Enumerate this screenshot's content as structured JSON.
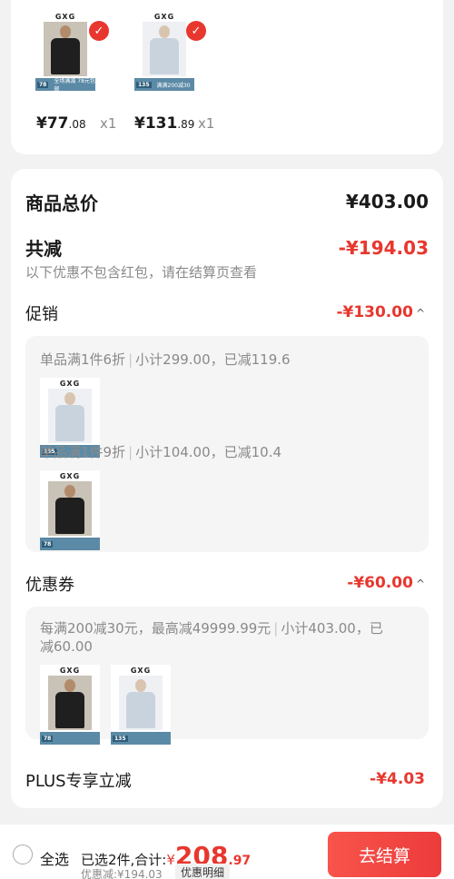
{
  "products": [
    {
      "brand": "GXG",
      "band_price": "78",
      "band_text": "全场满减 78元包邮",
      "price_int": "¥77",
      "price_dec": ".08",
      "qty": "x1",
      "variant": "dark"
    },
    {
      "brand": "GXG",
      "band_price": "135",
      "band_text": "满满200减30",
      "price_int": "¥131",
      "price_dec": ".89",
      "qty": "x1",
      "variant": "light"
    }
  ],
  "summary": {
    "total_label": "商品总价",
    "total_value": "¥403.00",
    "reduce_label": "共减",
    "reduce_value": "-¥194.03",
    "note": "以下优惠不包含红包，请在结算页查看"
  },
  "promo": {
    "label": "促销",
    "value": "-¥130.00",
    "caret": "^",
    "rules": [
      {
        "rule": "单品满1件6折",
        "detail": "小计299.00，已减119.6"
      },
      {
        "rule": "单品满1件9折",
        "detail": "小计104.00，已减10.4"
      }
    ]
  },
  "coupon": {
    "label": "优惠券",
    "value": "-¥60.00",
    "caret": "^",
    "rule_line1": "每满200减30元，最高减49999.99元",
    "rule_line1b": "小计403.00，已",
    "rule_line2": "减60.00"
  },
  "plus": {
    "label": "PLUS专享立减",
    "value": "-¥4.03"
  },
  "bottom": {
    "select_all": "全选",
    "selected_text": "已选2件,合计:",
    "currency": "¥",
    "total_int": "208",
    "total_dec": ".97",
    "discount_text": "优惠减:¥194.03",
    "detail_button": "优惠明细",
    "checkout_button": "去结算"
  },
  "colors": {
    "accent_red": "#e8372e",
    "band_blue": "#5b8aa6"
  }
}
